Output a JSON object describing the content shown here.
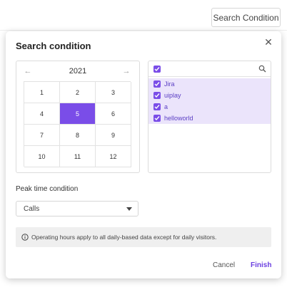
{
  "toolbar": {
    "search_condition_label": "Search Condition"
  },
  "dialog": {
    "title": "Search condition",
    "close_icon": "close-icon",
    "calendar": {
      "year": "2021",
      "prev_icon": "arrow-left-icon",
      "next_icon": "arrow-right-icon",
      "months": [
        "1",
        "2",
        "3",
        "4",
        "5",
        "6",
        "7",
        "8",
        "9",
        "10",
        "11",
        "12"
      ],
      "selected_month": "5"
    },
    "list": {
      "items": [
        {
          "label": "Jira",
          "checked": true
        },
        {
          "label": "uiplay",
          "checked": true
        },
        {
          "label": "a",
          "checked": true
        },
        {
          "label": "helloworld",
          "checked": true
        }
      ]
    },
    "peak": {
      "label": "Peak time condition",
      "selected": "Calls"
    },
    "info": "Operating hours apply to all daily-based data except for daily visitors.",
    "cancel_label": "Cancel",
    "finish_label": "Finish"
  },
  "colors": {
    "accent": "#7a4de8",
    "selected_row": "#ebe4fb"
  }
}
